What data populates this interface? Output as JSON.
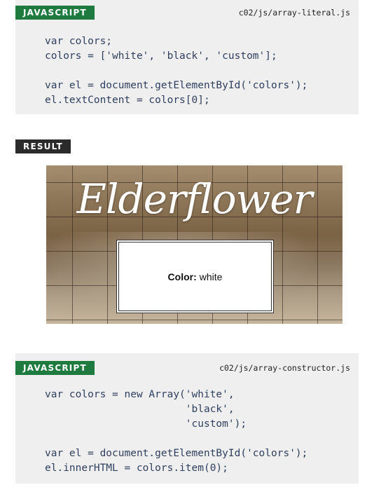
{
  "block1": {
    "tag": "JAVASCRIPT",
    "filename": "c02/js/array-literal.js",
    "code": "var colors;\ncolors = ['white', 'black', 'custom'];\n\nvar el = document.getElementById('colors');\nel.textContent = colors[0];"
  },
  "result": {
    "tag": "RESULT",
    "brand": "Elderflower",
    "label": "Color:",
    "value": "white"
  },
  "block2": {
    "tag": "JAVASCRIPT",
    "filename": "c02/js/array-constructor.js",
    "code": "var colors = new Array('white',\n                       'black',\n                       'custom');\n\nvar el = document.getElementById('colors');\nel.innerHTML = colors.item(0);"
  },
  "colors": {
    "js_tag": "#1f7a3f",
    "result_tag": "#2b2b2b",
    "panel_bg": "#efefef",
    "code_text": "#2f3f5f"
  }
}
